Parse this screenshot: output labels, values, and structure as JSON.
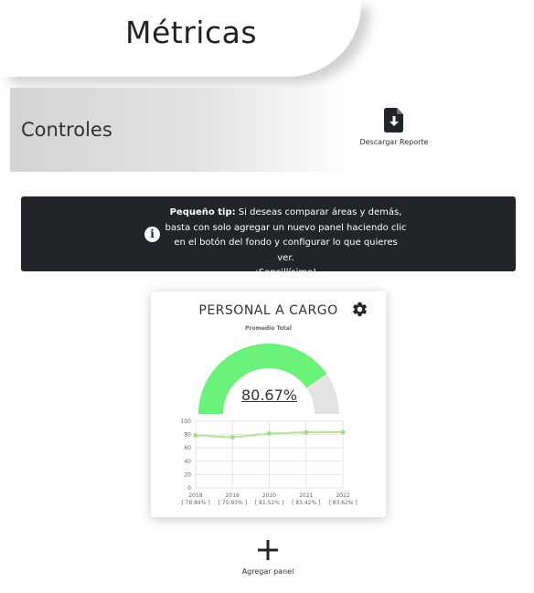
{
  "page": {
    "title": "Métricas"
  },
  "controls": {
    "label": "Controles",
    "download_label": "Descargar Reporte",
    "download_icon": "file-download-icon"
  },
  "tip": {
    "bold": "Pequeño tip:",
    "line1": "Si deseas comparar áreas y demás,",
    "line2": "basta con solo agregar un nuevo panel haciendo clic",
    "line3": "en el botón del fondo y configurar lo que quieres ver.",
    "line4": "¡Sencillísimo!",
    "icon": "info-icon"
  },
  "panel": {
    "title": "PERSONAL A CARGO",
    "settings_icon": "gear-icon"
  },
  "chart_data": [
    {
      "type": "gauge",
      "title": "Promedio Total",
      "value": 80.67,
      "value_label": "80.67%",
      "max": 100,
      "colors": {
        "fill": "#6af27a",
        "track": "#e4e4e4"
      }
    },
    {
      "type": "line",
      "x": [
        "2018",
        "2019",
        "2020",
        "2021",
        "2022"
      ],
      "x_sublabels": [
        "[ 78.84% ]",
        "[ 75.93% ]",
        "[ 81.52% ]",
        "[ 83.42% ]",
        "[ 83.62% ]"
      ],
      "series": [
        {
          "values": [
            78.84,
            75.93,
            81.52,
            83.42,
            83.62
          ]
        }
      ],
      "ylim": [
        0,
        100
      ],
      "yticks": [
        "0",
        "20",
        "40",
        "60",
        "80",
        "100"
      ],
      "grid": true,
      "colors": {
        "line": "#b4e39a",
        "point": "#a4dc88"
      }
    }
  ],
  "add_panel": {
    "label": "Agregar panel",
    "icon": "plus-icon"
  }
}
